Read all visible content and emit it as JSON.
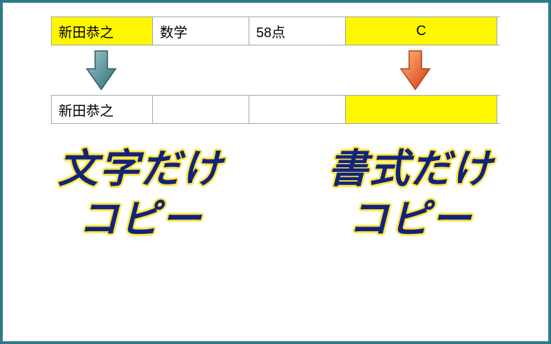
{
  "source_row": {
    "name": "新田恭之",
    "subject": "数学",
    "score": "58点",
    "grade": "C"
  },
  "dest_row": {
    "name": "新田恭之",
    "subject": "",
    "score": "",
    "grade": ""
  },
  "labels": {
    "left_line1": "文字だけ",
    "left_line2": "コピー",
    "right_line1": "書式だけ",
    "right_line2": "コピー"
  },
  "colors": {
    "border": "#2b7a8a",
    "highlight": "#fff700",
    "text_main": "#13237a",
    "text_outline": "#ffe84a",
    "arrow_teal": "#3f7a83",
    "arrow_orange": "#e8582c"
  }
}
